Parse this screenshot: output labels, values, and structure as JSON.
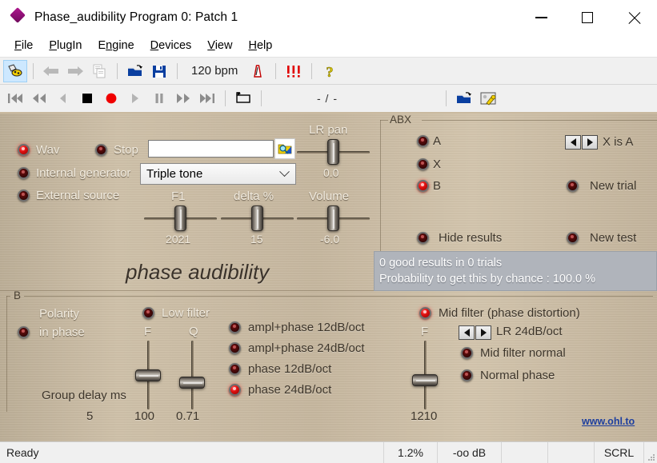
{
  "window": {
    "title": "Phase_audibility Program 0: Patch  1",
    "icon": "diamond-icon",
    "minimize_label": "—",
    "maximize_label": "□",
    "close_label": "✕"
  },
  "menu": {
    "items": [
      {
        "label": "File",
        "mnemonic": "F"
      },
      {
        "label": "PlugIn",
        "mnemonic": "P"
      },
      {
        "label": "Engine",
        "mnemonic": "n"
      },
      {
        "label": "Devices",
        "mnemonic": "D"
      },
      {
        "label": "View",
        "mnemonic": "V"
      },
      {
        "label": "Help",
        "mnemonic": "H"
      }
    ]
  },
  "toolbar": {
    "buttons": [
      {
        "name": "plugin-editor-icon",
        "active": true
      },
      {
        "name": "back-arrow-icon",
        "active": false
      },
      {
        "name": "forward-arrow-icon",
        "active": false
      },
      {
        "name": "copy-icon",
        "active": false
      },
      {
        "name": "open-folder-icon",
        "active": false
      },
      {
        "name": "save-icon",
        "active": false
      }
    ],
    "tempo": "120 bpm",
    "metronome_icon": "metronome-icon",
    "panic_icon": "panic-icon",
    "help_icon": "help-icon"
  },
  "transport": {
    "buttons": [
      "skip-start-icon",
      "rewind-icon",
      "step-back-icon",
      "stop-icon",
      "record-icon",
      "play-icon",
      "pause-icon",
      "fast-forward-icon",
      "skip-end-icon",
      "loop-icon"
    ],
    "position": "- / -",
    "right_buttons": [
      "open-session-icon",
      "session-settings-icon"
    ]
  },
  "plugin": {
    "title": "phase audibility",
    "brand": "www.ohl.to",
    "source": {
      "options": [
        {
          "label": "Wav",
          "on": true
        },
        {
          "label": "Internal generator",
          "on": false
        },
        {
          "label": "External source",
          "on": false
        }
      ],
      "stop": {
        "label": "Stop",
        "on": false
      },
      "wav_path": "",
      "wav_placeholder": "",
      "browse_icon": "browse-file-icon",
      "generator": {
        "selected": "Triple tone",
        "options": [
          "Triple tone"
        ]
      }
    },
    "sliders_top": [
      {
        "name": "F1",
        "value": "2021"
      },
      {
        "name": "delta %",
        "value": "15"
      },
      {
        "name": "LR pan",
        "value": "0.0"
      },
      {
        "name": "Volume",
        "value": "-6.0"
      }
    ],
    "abx": {
      "group_label": "ABX",
      "options": [
        {
          "label": "A",
          "on": false
        },
        {
          "label": "X",
          "on": false
        },
        {
          "label": "B",
          "on": true
        }
      ],
      "x_is": "X is A",
      "new_trial": {
        "label": "New trial",
        "on": false
      },
      "hide_results": {
        "label": "Hide  results",
        "on": false
      },
      "new_test": {
        "label": "New test",
        "on": false
      },
      "results": [
        "0 good results in 0 trials",
        "Probability to get this by chance : 100.0 %"
      ]
    },
    "section_b": {
      "group_label": "B",
      "polarity_title": "Polarity",
      "polarity": {
        "label": "in phase",
        "on": false
      },
      "group_delay_label": "Group delay ms",
      "group_delay_value": "5",
      "low_filter": {
        "label": "Low filter",
        "on": false
      },
      "low_filter_sliders": [
        {
          "name": "F",
          "value": "100"
        },
        {
          "name": "Q",
          "value": "0.71"
        }
      ],
      "filter_modes": [
        {
          "label": "ampl+phase 12dB/oct",
          "on": false
        },
        {
          "label": "ampl+phase 24dB/oct",
          "on": false
        },
        {
          "label": "phase 12dB/oct",
          "on": false
        },
        {
          "label": "phase 24dB/oct",
          "on": true
        }
      ],
      "mid_filter": {
        "label": "Mid filter (phase distortion)",
        "on": true
      },
      "mid_filter_slider": {
        "name": "F",
        "value": "1210"
      },
      "mid_type": "LR 24dB/oct",
      "mid_normal": {
        "label": "Mid filter normal",
        "on": false
      },
      "normal_phase": {
        "label": "Normal phase",
        "on": false
      }
    }
  },
  "statusbar": {
    "message": "Ready",
    "cpu": "1.2%",
    "level": "-oo dB",
    "cell4": "",
    "cell5": "",
    "scroll": "SCRL"
  },
  "colors": {
    "accent": "#8f0f76",
    "led_on": "#e01010",
    "led_off": "#4d0a0a",
    "panel_bg": "#c6b79f",
    "brand": "#1e3f9e",
    "results_bg": "#b0b4bb"
  }
}
